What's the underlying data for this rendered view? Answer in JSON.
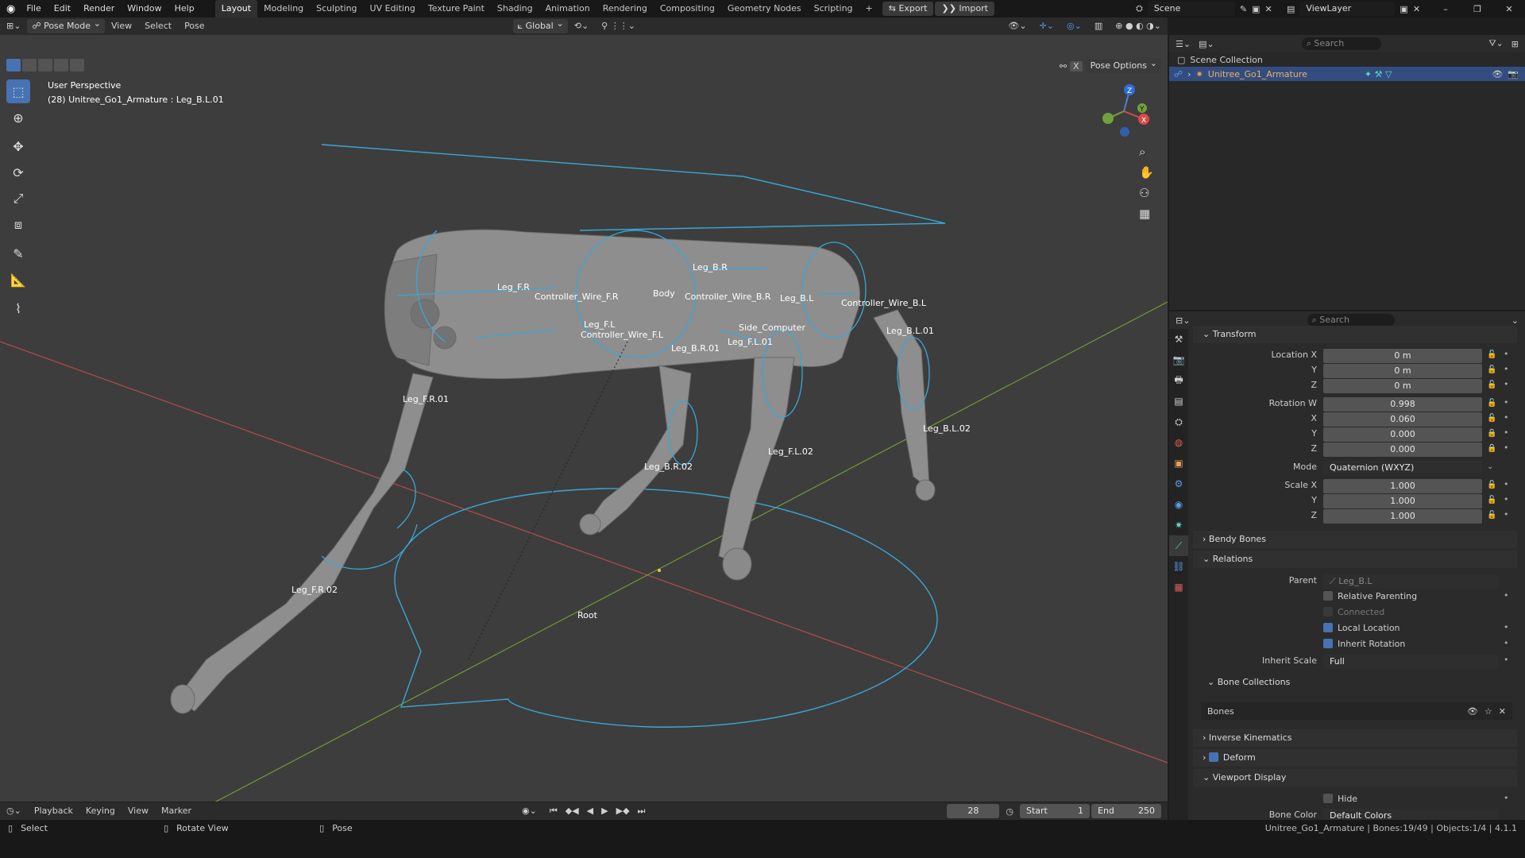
{
  "topbar": {
    "menus": [
      "File",
      "Edit",
      "Render",
      "Window",
      "Help"
    ],
    "workspaces": [
      "Layout",
      "Modeling",
      "Sculpting",
      "UV Editing",
      "Texture Paint",
      "Shading",
      "Animation",
      "Rendering",
      "Compositing",
      "Geometry Nodes",
      "Scripting"
    ],
    "active_workspace": "Layout",
    "add_tab": "+",
    "export": "Export",
    "import": "Import",
    "scene": "Scene",
    "viewlayer": "ViewLayer"
  },
  "viewport_header": {
    "mode": "Pose Mode",
    "menus": [
      "View",
      "Select",
      "Pose"
    ],
    "orientation": "Global",
    "pose_options": "Pose Options",
    "x_label": "X"
  },
  "viewport": {
    "perspective": "User Perspective",
    "active": "(28) Unitree_Go1_Armature : Leg_B.L.01",
    "bones": [
      "Leg_B.R",
      "Leg_F.R",
      "Controller_Wire_F.R",
      "Body",
      "Controller_Wire_B.R",
      "Leg_B.L",
      "Controller_Wire_B.L",
      "Leg_F.L",
      "Controller_Wire_F.L",
      "Side_Computer",
      "Leg_B.L.01",
      "Leg_B.R.01",
      "Leg_F.L.01",
      "Leg_F.R.01",
      "Leg_B.L.02",
      "Leg_F.L.02",
      "Leg_B.R.02",
      "Leg_F.R.02",
      "Root"
    ],
    "gizmo": {
      "x": "X",
      "y": "Y",
      "z": "Z"
    }
  },
  "outliner": {
    "search_placeholder": "Search",
    "collection": "Scene Collection",
    "item": "Unitree_Go1_Armature"
  },
  "properties": {
    "search_placeholder": "Search",
    "transform": "Transform",
    "location": {
      "label_x": "Location X",
      "label_y": "Y",
      "label_z": "Z",
      "x": "0 m",
      "y": "0 m",
      "z": "0 m"
    },
    "rotation": {
      "label_w": "Rotation W",
      "label_x": "X",
      "label_y": "Y",
      "label_z": "Z",
      "w": "0.998",
      "x": "0.060",
      "y": "0.000",
      "z": "0.000"
    },
    "mode_label": "Mode",
    "mode": "Quaternion (WXYZ)",
    "scale": {
      "label_x": "Scale X",
      "label_y": "Y",
      "label_z": "Z",
      "x": "1.000",
      "y": "1.000",
      "z": "1.000"
    },
    "bendy_bones": "Bendy Bones",
    "relations": "Relations",
    "parent_label": "Parent",
    "parent": "Leg_B.L",
    "relative_parenting": "Relative Parenting",
    "connected": "Connected",
    "local_location": "Local Location",
    "inherit_rotation": "Inherit Rotation",
    "inherit_scale_label": "Inherit Scale",
    "inherit_scale": "Full",
    "bone_collections": "Bone Collections",
    "bones_item": "Bones",
    "inverse_kinematics": "Inverse Kinematics",
    "deform": "Deform",
    "viewport_display": "Viewport Display",
    "hide": "Hide",
    "bone_color_label": "Bone Color",
    "bone_color": "Default Colors"
  },
  "timeline": {
    "menus": [
      "Playback",
      "Keying",
      "View",
      "Marker"
    ],
    "frame": "28",
    "start_label": "Start",
    "start": "1",
    "end_label": "End",
    "end": "250"
  },
  "status": {
    "select": "Select",
    "rotate": "Rotate View",
    "pose": "Pose",
    "info": "Unitree_Go1_Armature | Bones:19/49 | Objects:1/4 | 4.1.1"
  },
  "colors": {
    "accent": "#4772b3",
    "bone_outline": "#37a8d8",
    "x_axis": "#c94a4a",
    "y_axis": "#7aa23a"
  }
}
